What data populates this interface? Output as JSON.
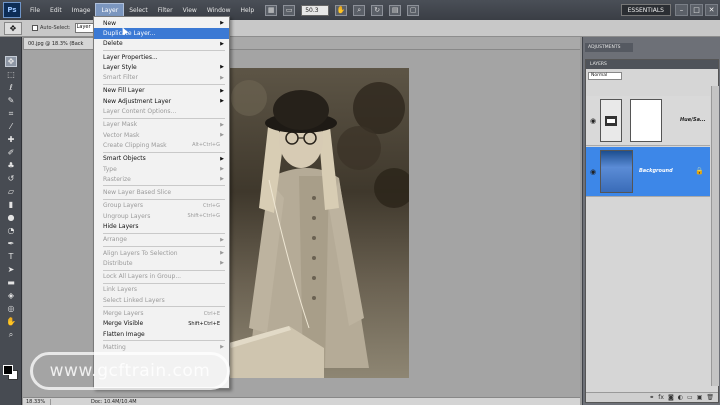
{
  "menubar": {
    "app_logo": "Ps",
    "items": [
      "File",
      "Edit",
      "Image",
      "Layer",
      "Select",
      "Filter",
      "View",
      "Window",
      "Help"
    ],
    "zoom_level": "50.3",
    "workspace": "ESSENTIALS",
    "window_controls": [
      "–",
      "□",
      "✕"
    ]
  },
  "options_bar": {
    "auto_select_label": "Auto-Select:",
    "auto_select_value": "Layer"
  },
  "document": {
    "tab_title": "00.jpg @ 18.3% (Back",
    "zoom_percent": "18.33%",
    "info": "Doc: 10.4M/10.4M"
  },
  "layer_menu": {
    "items": [
      {
        "label": "New",
        "arrow": true
      },
      {
        "label": "Duplicate Layer...",
        "highlight": true
      },
      {
        "label": "Delete",
        "arrow": true
      },
      {
        "sep": true
      },
      {
        "label": "Layer Properties..."
      },
      {
        "label": "Layer Style",
        "arrow": true
      },
      {
        "label": "Smart Filter",
        "disabled": true,
        "arrow": true
      },
      {
        "sep": true
      },
      {
        "label": "New Fill Layer",
        "arrow": true
      },
      {
        "label": "New Adjustment Layer",
        "arrow": true
      },
      {
        "label": "Layer Content Options...",
        "disabled": true
      },
      {
        "sep": true
      },
      {
        "label": "Layer Mask",
        "disabled": true,
        "arrow": true
      },
      {
        "label": "Vector Mask",
        "disabled": true,
        "arrow": true
      },
      {
        "label": "Create Clipping Mask",
        "disabled": true,
        "shortcut": "Alt+Ctrl+G"
      },
      {
        "sep": true
      },
      {
        "label": "Smart Objects",
        "arrow": true
      },
      {
        "label": "Type",
        "disabled": true,
        "arrow": true
      },
      {
        "label": "Rasterize",
        "disabled": true,
        "arrow": true
      },
      {
        "sep": true
      },
      {
        "label": "New Layer Based Slice",
        "disabled": true
      },
      {
        "sep": true
      },
      {
        "label": "Group Layers",
        "disabled": true,
        "shortcut": "Ctrl+G"
      },
      {
        "label": "Ungroup Layers",
        "disabled": true,
        "shortcut": "Shift+Ctrl+G"
      },
      {
        "label": "Hide Layers"
      },
      {
        "sep": true
      },
      {
        "label": "Arrange",
        "disabled": true,
        "arrow": true
      },
      {
        "sep": true
      },
      {
        "label": "Align Layers To Selection",
        "disabled": true,
        "arrow": true
      },
      {
        "label": "Distribute",
        "disabled": true,
        "arrow": true
      },
      {
        "sep": true
      },
      {
        "label": "Lock All Layers in Group...",
        "disabled": true
      },
      {
        "sep": true
      },
      {
        "label": "Link Layers",
        "disabled": true
      },
      {
        "label": "Select Linked Layers",
        "disabled": true
      },
      {
        "sep": true
      },
      {
        "label": "Merge Layers",
        "disabled": true,
        "shortcut": "Ctrl+E"
      },
      {
        "label": "Merge Visible",
        "shortcut": "Shift+Ctrl+E"
      },
      {
        "label": "Flatten Image"
      },
      {
        "sep": true
      },
      {
        "label": "Matting",
        "disabled": true,
        "arrow": true
      }
    ]
  },
  "panels": {
    "adjustments_tab": "ADJUSTMENTS",
    "layers_tab": "LAYERS",
    "blend_mode": "Normal",
    "layers": [
      {
        "name": "Hue/Sa...",
        "selected": false
      },
      {
        "name": "Background",
        "selected": true
      }
    ]
  },
  "watermark": "www.gcftrain.com",
  "colors": {
    "menubar": "#3a3e45",
    "highlight": "#3b79d4",
    "selected_layer": "#3d87e8"
  }
}
